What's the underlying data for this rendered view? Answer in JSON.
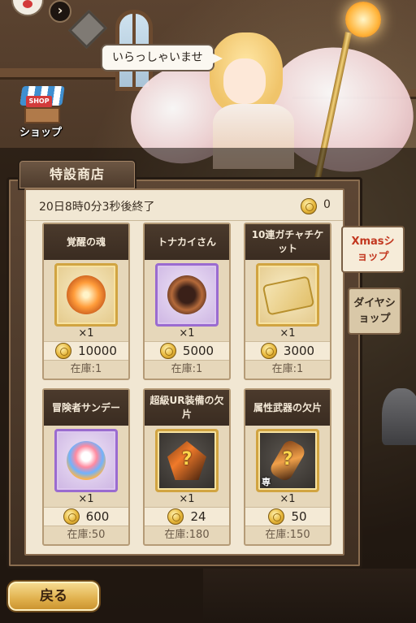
{
  "header": {
    "speech": "いらっしゃいませ",
    "shop_label": "ショップ",
    "shop_sign": "SHOP",
    "nav_arrow": "›"
  },
  "panel": {
    "title": "特設商店",
    "timer": "20日8時0分3秒後終了",
    "coin_count": "0"
  },
  "side_tabs": [
    {
      "label": "Xmasショップ",
      "active": true
    },
    {
      "label": "ダイヤショップ",
      "active": false
    }
  ],
  "items": [
    {
      "name": "覚醒の魂",
      "qty": "×1",
      "price": "10000",
      "stock": "在庫:1",
      "icon": "awakening-soul-icon",
      "frame": "gold"
    },
    {
      "name": "トナカイさん",
      "qty": "×1",
      "price": "5000",
      "stock": "在庫:1",
      "icon": "reindeer-icon",
      "frame": "purple"
    },
    {
      "name": "10連ガチャチケット",
      "qty": "×1",
      "price": "3000",
      "stock": "在庫:1",
      "icon": "gacha-ticket-icon",
      "frame": "gold"
    },
    {
      "name": "冒険者サンデー",
      "qty": "×1",
      "price": "600",
      "stock": "在庫:50",
      "icon": "sundae-icon",
      "frame": "purple"
    },
    {
      "name": "超級UR装備の欠片",
      "qty": "×1",
      "price": "24",
      "stock": "在庫:180",
      "icon": "ur-armor-shard-icon",
      "frame": "dark",
      "mark": "?"
    },
    {
      "name": "属性武器の欠片",
      "qty": "×1",
      "price": "50",
      "stock": "在庫:150",
      "icon": "weapon-shard-icon",
      "frame": "dark",
      "mark": "?",
      "tag": "専"
    }
  ],
  "footer": {
    "back_label": "戻る"
  },
  "colors": {
    "accent_red": "#c2371f",
    "panel_bg": "#f1e7d3",
    "gold": "#e0b04c"
  }
}
